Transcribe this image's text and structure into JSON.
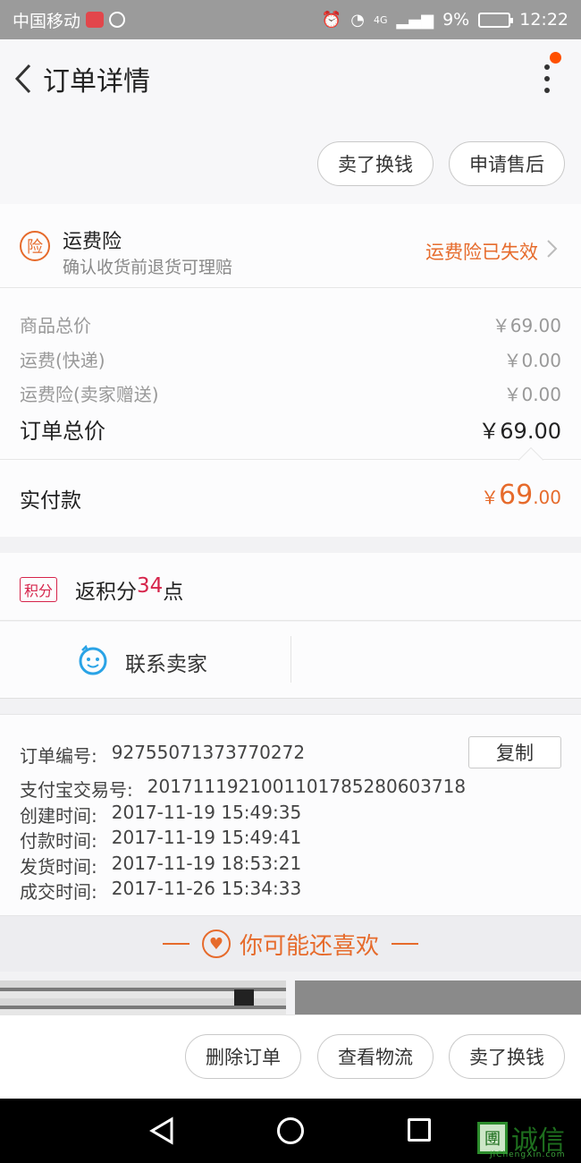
{
  "status_bar": {
    "carrier": "中国移动",
    "network": "4G",
    "battery": "9%",
    "time": "12:22"
  },
  "header": {
    "title": "订单详情"
  },
  "top_actions": {
    "sell_exchange": "卖了换钱",
    "after_sales": "申请售后"
  },
  "insurance": {
    "badge": "险",
    "title": "运费险",
    "subtitle": "确认收货前退货可理赔",
    "status": "运费险已失效"
  },
  "prices": {
    "rows": [
      {
        "label": "商品总价",
        "value": "￥69.00"
      },
      {
        "label": "运费(快递)",
        "value": "￥0.00"
      },
      {
        "label": "运费险(卖家赠送)",
        "value": "￥0.00"
      }
    ],
    "total_label": "订单总价",
    "total_value": "￥69.00"
  },
  "payment": {
    "label": "实付款",
    "symbol": "￥",
    "integer": "69",
    "decimal": ".00"
  },
  "points": {
    "badge": "积分",
    "prefix": "返积分",
    "amount": "34",
    "suffix": "点"
  },
  "contact": {
    "label": "联系卖家"
  },
  "order_info": {
    "copy_label": "复制",
    "rows": [
      {
        "label": "订单编号:",
        "value": "92755071373770272"
      },
      {
        "label": "支付宝交易号:",
        "value": "2017111921001101785280603718"
      },
      {
        "label": "创建时间:",
        "value": "2017-11-19 15:49:35"
      },
      {
        "label": "付款时间:",
        "value": "2017-11-19 15:49:41"
      },
      {
        "label": "发货时间:",
        "value": "2017-11-19 18:53:21"
      },
      {
        "label": "成交时间:",
        "value": "2017-11-26 15:34:33"
      }
    ]
  },
  "recommend": {
    "title": "你可能还喜欢"
  },
  "bottom_actions": {
    "delete": "删除订单",
    "logistics": "查看物流",
    "sell_exchange": "卖了换钱"
  },
  "watermark": {
    "mark": "圑",
    "text": "诚信",
    "url": "JiChengXin.com"
  },
  "colors": {
    "accent": "#e66b2c",
    "points_red": "#d6244b",
    "notification": "#ff5000"
  }
}
